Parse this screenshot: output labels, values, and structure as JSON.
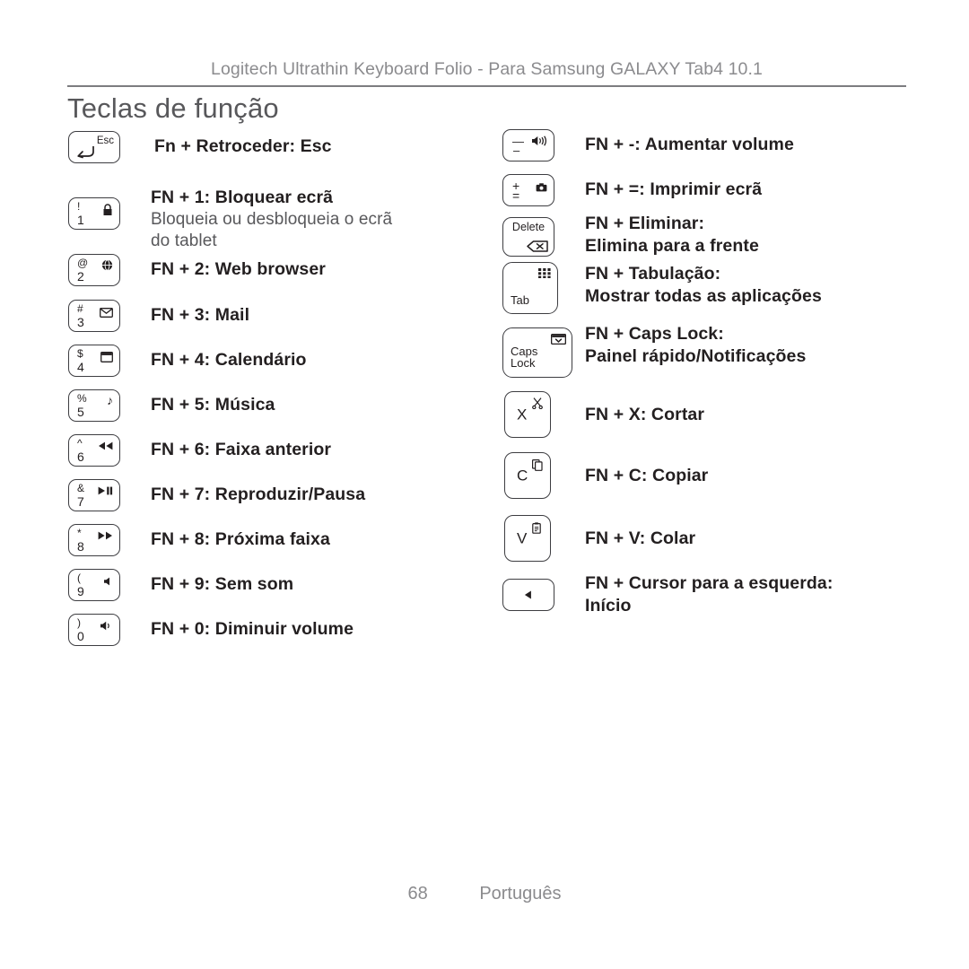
{
  "header": {
    "title": "Logitech Ultrathin Keyboard Folio - Para Samsung GALAXY Tab4 10.1"
  },
  "page_title": "Teclas de função",
  "footer": {
    "page_number": "68",
    "language": "Português"
  },
  "colors": {
    "header_text": "#8b8b8e",
    "title_text": "#58585b",
    "body_bold": "#231f20",
    "body_sub": "#58585b",
    "key_outline": "#3d3d41",
    "rule": "#7d7d80"
  },
  "left_column": [
    {
      "key": {
        "type": "wide",
        "word_top_right": "Esc",
        "icon_bottom_left": "back-arrow-icon"
      },
      "title": "Fn + Retroceder: Esc",
      "sub": []
    },
    {
      "key": {
        "type": "wide",
        "top_left": "!",
        "bottom_left": "1",
        "icon_top_right": "lock-icon"
      },
      "title": "FN + 1: Bloquear ecrã",
      "sub": [
        "Bloqueia ou desbloqueia o ecrã",
        "do tablet"
      ]
    },
    {
      "key": {
        "type": "wide",
        "top_left": "@",
        "bottom_left": "2",
        "icon_top_right": "web-browser-icon"
      },
      "title": "FN + 2: Web browser",
      "sub": []
    },
    {
      "key": {
        "type": "wide",
        "top_left": "#",
        "bottom_left": "3",
        "icon_top_right": "mail-icon"
      },
      "title": "FN + 3: Mail",
      "sub": []
    },
    {
      "key": {
        "type": "wide",
        "top_left": "$",
        "bottom_left": "4",
        "icon_top_right": "calendar-icon"
      },
      "title": "FN + 4: Calendário",
      "sub": []
    },
    {
      "key": {
        "type": "wide",
        "top_left": "%",
        "bottom_left": "5",
        "icon_top_right": "music-note-icon"
      },
      "title": "FN + 5: Música",
      "sub": []
    },
    {
      "key": {
        "type": "wide",
        "top_left": "^",
        "bottom_left": "6",
        "icon_top_right": "previous-track-icon"
      },
      "title": "FN + 6: Faixa anterior",
      "sub": []
    },
    {
      "key": {
        "type": "wide",
        "top_left": "&",
        "bottom_left": "7",
        "icon_top_right": "play-pause-icon"
      },
      "title": "FN + 7: Reproduzir/Pausa",
      "sub": []
    },
    {
      "key": {
        "type": "wide",
        "top_left": "*",
        "bottom_left": "8",
        "icon_top_right": "next-track-icon"
      },
      "title": "FN + 8: Próxima faixa",
      "sub": []
    },
    {
      "key": {
        "type": "wide",
        "top_left": "(",
        "bottom_left": "9",
        "icon_top_right": "mute-icon"
      },
      "title": "FN + 9: Sem som",
      "sub": []
    },
    {
      "key": {
        "type": "wide",
        "top_left": ")",
        "bottom_left": "0",
        "icon_top_right": "volume-down-icon"
      },
      "title": "FN + 0: Diminuir volume",
      "sub": []
    }
  ],
  "right_column": [
    {
      "key": {
        "type": "wide",
        "top_left": "—",
        "bottom_left": "–",
        "icon_top_right": "volume-up-icon"
      },
      "title": "FN + -: Aumentar volume",
      "sub": []
    },
    {
      "key": {
        "type": "wide",
        "top_left": "+",
        "bottom_left": "=",
        "icon_top_right": "print-screen-icon"
      },
      "title": "FN + =: Imprimir ecrã",
      "sub": []
    },
    {
      "key": {
        "type": "delete",
        "word_top": "Delete",
        "icon_bottom_right": "backspace-icon"
      },
      "title": "FN + Eliminar:",
      "sub_bold": [
        "Elimina para a frente"
      ],
      "sub": []
    },
    {
      "key": {
        "type": "tab",
        "word_bottom_left": "Tab",
        "icon_top_right": "app-grid-icon"
      },
      "title": "FN + Tabulação:",
      "sub_bold": [
        "Mostrar todas as aplicações"
      ],
      "sub": []
    },
    {
      "key": {
        "type": "caps",
        "word_bottom_left": "Caps\nLock",
        "icon_top_right": "notification-panel-icon"
      },
      "title": "FN + Caps Lock:",
      "sub_bold": [
        "Painel rápido/Notificações"
      ],
      "sub": []
    },
    {
      "key": {
        "type": "square",
        "letter": "X",
        "icon_top_right": "scissors-icon"
      },
      "title": "FN + X: Cortar",
      "sub": []
    },
    {
      "key": {
        "type": "square",
        "letter": "C",
        "icon_top_right": "copy-icon"
      },
      "title": "FN + C: Copiar",
      "sub": []
    },
    {
      "key": {
        "type": "square",
        "letter": "V",
        "icon_top_right": "paste-icon"
      },
      "title": "FN + V: Colar",
      "sub": []
    },
    {
      "key": {
        "type": "arrow",
        "icon_center": "arrow-left-icon"
      },
      "title": "FN + Cursor para a esquerda:",
      "sub_bold": [
        "Início"
      ],
      "sub": []
    }
  ]
}
